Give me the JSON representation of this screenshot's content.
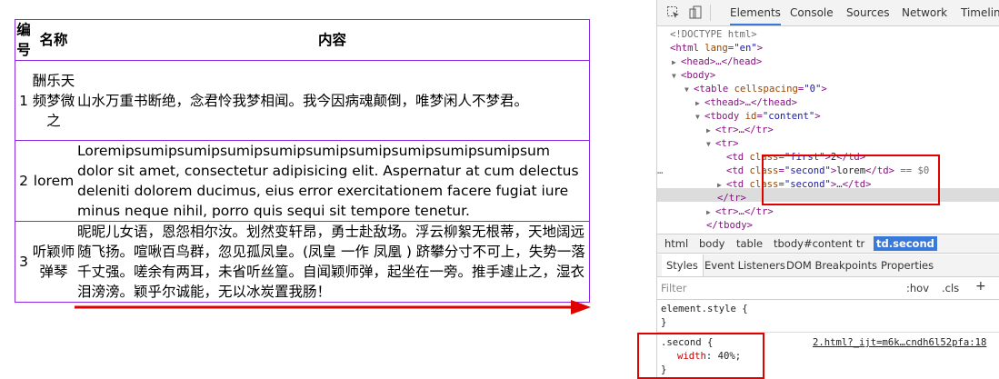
{
  "page_table": {
    "headers": {
      "num": "编号",
      "name": "名称",
      "content": "内容"
    },
    "rows": [
      {
        "num": "1",
        "name": "酬乐天频梦微之",
        "content": "山水万重书断绝，念君怜我梦相闻。我今因病魂颠倒，唯梦闲人不梦君。"
      },
      {
        "num": "2",
        "name": "lorem",
        "content": "Loremipsumipsumipsumipsumipsumipsumipsumipsumipsumipsum dolor sit amet, consectetur adipisicing elit. Aspernatur at cum delectus deleniti dolorem ducimus, eius error exercitationem facere fugiat iure minus neque nihil, porro quis sequi sit tempore tenetur."
      },
      {
        "num": "3",
        "name": "听颖师弹琴",
        "content": "昵昵儿女语，恩怨相尔汝。划然变轩昂，勇士赴敌场。浮云柳絮无根蒂，天地阔远随飞扬。喧啾百鸟群，忽见孤凤皇。(凤皇 一作 凤凰 ) 跻攀分寸不可上，失势一落千丈强。嗟余有两耳，未省听丝篁。自闻颖师弹，起坐在一旁。推手遽止之，湿衣泪滂滂。颖乎尔诚能，无以冰炭置我肠！"
      }
    ]
  },
  "devtools": {
    "tabs": [
      "Elements",
      "Console",
      "Sources",
      "Network",
      "Timeline"
    ],
    "active_tab": "Elements",
    "dom": {
      "doctype": "<!DOCTYPE html>",
      "html_open_tag": "html",
      "html_lang_attr": "lang",
      "html_lang_val": "\"en\"",
      "head_collapsed": "<head>…</head>",
      "body_open": "<body>",
      "table_tag": "table",
      "table_attr": "cellspacing",
      "table_val": "\"0\"",
      "thead_collapsed": "<thead>…</thead>",
      "tbody_tag": "tbody",
      "tbody_attr": "id",
      "tbody_val": "\"content\"",
      "tr_collapsed": "<tr>…</tr>",
      "tr_open": "<tr>",
      "td_tag": "td",
      "class_attr": "class",
      "first_val": "\"first\"",
      "first_text": "2",
      "td_close": "</td>",
      "second_val": "\"second\"",
      "second_text": "lorem",
      "selected_marker": "== $0",
      "ellipsis_close": "…</td>",
      "tr_close": "</tr>",
      "tbody_close": "</tbody>"
    },
    "breadcrumbs": [
      "html",
      "body",
      "table",
      "tbody#content",
      "tr",
      "td.second"
    ],
    "active_breadcrumb": "td.second",
    "styles_tabs": [
      "Styles",
      "Event Listeners",
      "DOM Breakpoints",
      "Properties"
    ],
    "active_styles_tab": "Styles",
    "filter_placeholder": "Filter",
    "filter_hov": ":hov",
    "filter_cls": ".cls",
    "filter_add": "+",
    "element_style_selector": "element.style {",
    "brace_close": "}",
    "rule_selector": ".second {",
    "rule_source": "2.html?_ijt=m6k…cndh6l52pfa:18",
    "rule_prop": "width",
    "rule_value": "40%;"
  },
  "colors": {
    "table_border": "#8a2be2",
    "arrow": "#e00000",
    "callout": "#e00000",
    "selection": "#3879d9"
  }
}
